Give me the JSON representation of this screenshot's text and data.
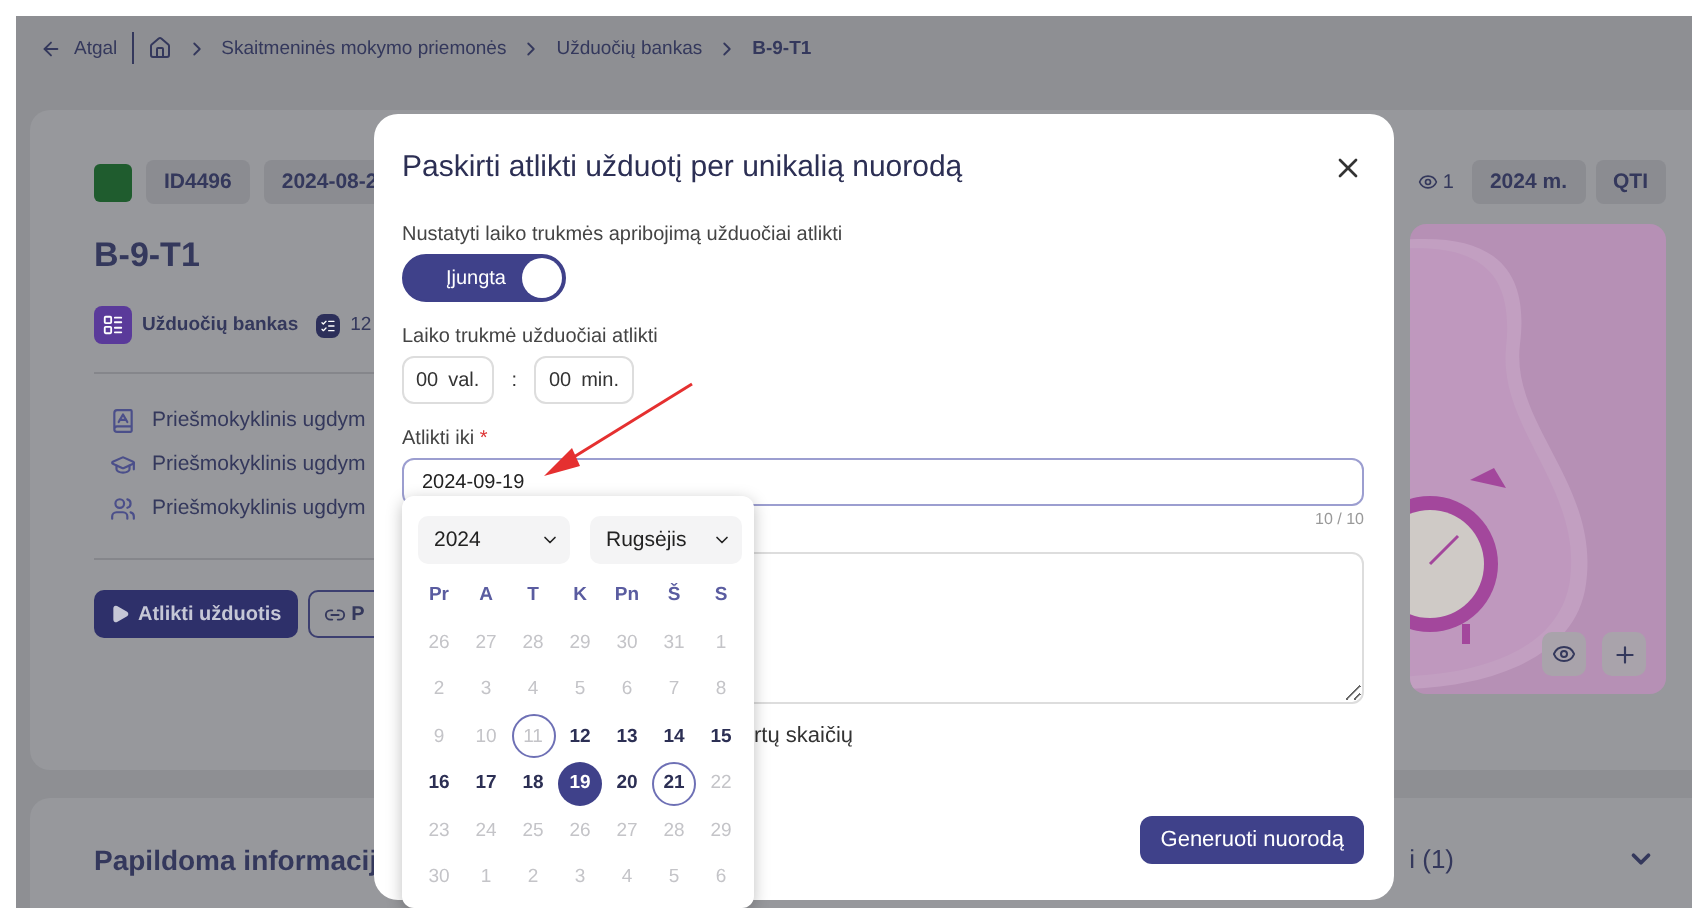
{
  "nav": {
    "back": "Atgal",
    "crumbs": [
      "Skaitmeninės mokymo priemonės",
      "Užduočių bankas",
      "B-9-T1"
    ]
  },
  "resource": {
    "chips": [
      "ID4496",
      "2024-08-2"
    ],
    "title": "B-9-T1",
    "source": "Užduočių bankas",
    "count": "12",
    "details": [
      {
        "kind": "book",
        "text": "Priešmokyklinis ugdym"
      },
      {
        "kind": "cap",
        "text": "Priešmokyklinis ugdym"
      },
      {
        "kind": "people",
        "text": "Priešmokyklinis ugdym"
      }
    ],
    "primary_action": "Atlikti užduotis",
    "secondary_action": "P",
    "views": "1",
    "year": "2024 m.",
    "format": "QTI",
    "image": {
      "kind": "picture"
    }
  },
  "more_info": {
    "title": "Papildoma informacij",
    "tail": "i (1)"
  },
  "modal": {
    "title": "Paskirti atlikti užduotį per unikalią nuorodą",
    "limit_label": "Nustatyti laiko trukmės apribojimą užduočiai atlikti",
    "limit_on": true,
    "limit_text": "Įjungta",
    "duration_label": "Laiko trukmė užduočiai atlikti",
    "hours": "00",
    "hours_unit": "val.",
    "separator": ":",
    "minutes": "00",
    "minutes_unit": "min.",
    "due_label": "Atlikti iki",
    "required_mark": "*",
    "due_value": "2024-09-19",
    "due_counter": "10 / 10",
    "partial_label": "rtų skaičių",
    "submit": "Generuoti nuorodą",
    "annotation": {
      "kind": "arrow"
    }
  },
  "datepicker": {
    "year": "2024",
    "month": "Rugsėjis",
    "weekdays": [
      "Pr",
      "A",
      "T",
      "K",
      "Pn",
      "Š",
      "S"
    ],
    "weeks": [
      [
        {
          "label": "26",
          "muted": true,
          "selected": false,
          "circled": false
        },
        {
          "label": "27",
          "muted": true,
          "selected": false,
          "circled": false
        },
        {
          "label": "28",
          "muted": true,
          "selected": false,
          "circled": false
        },
        {
          "label": "29",
          "muted": true,
          "selected": false,
          "circled": false
        },
        {
          "label": "30",
          "muted": true,
          "selected": false,
          "circled": false
        },
        {
          "label": "31",
          "muted": true,
          "selected": false,
          "circled": false
        },
        {
          "label": "1",
          "muted": true,
          "selected": false,
          "circled": false
        }
      ],
      [
        {
          "label": "2",
          "muted": true,
          "selected": false,
          "circled": false
        },
        {
          "label": "3",
          "muted": true,
          "selected": false,
          "circled": false
        },
        {
          "label": "4",
          "muted": true,
          "selected": false,
          "circled": false
        },
        {
          "label": "5",
          "muted": true,
          "selected": false,
          "circled": false
        },
        {
          "label": "6",
          "muted": true,
          "selected": false,
          "circled": false
        },
        {
          "label": "7",
          "muted": true,
          "selected": false,
          "circled": false
        },
        {
          "label": "8",
          "muted": true,
          "selected": false,
          "circled": false
        }
      ],
      [
        {
          "label": "9",
          "muted": true,
          "selected": false,
          "circled": false
        },
        {
          "label": "10",
          "muted": true,
          "selected": false,
          "circled": false
        },
        {
          "label": "11",
          "muted": true,
          "selected": false,
          "circled": true
        },
        {
          "label": "12",
          "muted": false,
          "selected": false,
          "circled": false
        },
        {
          "label": "13",
          "muted": false,
          "selected": false,
          "circled": false
        },
        {
          "label": "14",
          "muted": false,
          "selected": false,
          "circled": false
        },
        {
          "label": "15",
          "muted": false,
          "selected": false,
          "circled": false
        }
      ],
      [
        {
          "label": "16",
          "muted": false,
          "selected": false,
          "circled": false
        },
        {
          "label": "17",
          "muted": false,
          "selected": false,
          "circled": false
        },
        {
          "label": "18",
          "muted": false,
          "selected": false,
          "circled": false
        },
        {
          "label": "19",
          "muted": false,
          "selected": true,
          "circled": false
        },
        {
          "label": "20",
          "muted": false,
          "selected": false,
          "circled": false
        },
        {
          "label": "21",
          "muted": false,
          "selected": false,
          "circled": true
        },
        {
          "label": "22",
          "muted": true,
          "selected": false,
          "circled": false
        }
      ],
      [
        {
          "label": "23",
          "muted": true,
          "selected": false,
          "circled": false
        },
        {
          "label": "24",
          "muted": true,
          "selected": false,
          "circled": false
        },
        {
          "label": "25",
          "muted": true,
          "selected": false,
          "circled": false
        },
        {
          "label": "26",
          "muted": true,
          "selected": false,
          "circled": false
        },
        {
          "label": "27",
          "muted": true,
          "selected": false,
          "circled": false
        },
        {
          "label": "28",
          "muted": true,
          "selected": false,
          "circled": false
        },
        {
          "label": "29",
          "muted": true,
          "selected": false,
          "circled": false
        }
      ],
      [
        {
          "label": "30",
          "muted": true,
          "selected": false,
          "circled": false
        },
        {
          "label": "1",
          "muted": true,
          "selected": false,
          "circled": false
        },
        {
          "label": "2",
          "muted": true,
          "selected": false,
          "circled": false
        },
        {
          "label": "3",
          "muted": true,
          "selected": false,
          "circled": false
        },
        {
          "label": "4",
          "muted": true,
          "selected": false,
          "circled": false
        },
        {
          "label": "5",
          "muted": true,
          "selected": false,
          "circled": false
        },
        {
          "label": "6",
          "muted": true,
          "selected": false,
          "circled": false
        }
      ]
    ]
  }
}
